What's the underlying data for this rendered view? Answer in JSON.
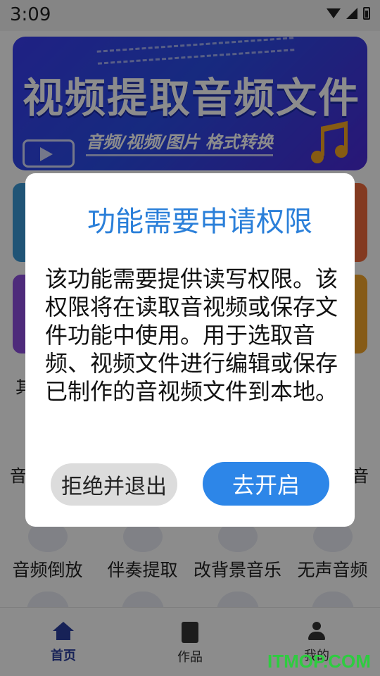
{
  "status_bar": {
    "time": "3:09"
  },
  "banner": {
    "title": "视频提取音频文件",
    "subtitle": "音频/视频/图片 格式转换"
  },
  "background_fragments": {
    "left_1": "其",
    "left_2": "音",
    "right_2": "音"
  },
  "functions": [
    {
      "label": "音频倒放"
    },
    {
      "label": "伴奏提取"
    },
    {
      "label": "改背景音乐"
    },
    {
      "label": "无声音频"
    }
  ],
  "bottom_nav": {
    "items": [
      {
        "label": "首页",
        "icon": "home-icon",
        "active": true
      },
      {
        "label": "作品",
        "icon": "document-icon",
        "active": false
      },
      {
        "label": "我的",
        "icon": "user-icon",
        "active": false
      }
    ]
  },
  "dialog": {
    "title": "功能需要申请权限",
    "body": "该功能需要提供读写权限。该权限将在读取音视频或保存文件功能中使用。用于选取音频、视频文件进行编辑或保存已制作的音视频文件到本地。",
    "refuse_button": "拒绝并退出",
    "confirm_button": "去开启"
  },
  "watermark": "ITMOP.COM",
  "colors": {
    "accent": "#2d86e8",
    "title_blue": "#2a7fd9",
    "nav_active": "#2a3f9e",
    "watermark": "#2ecc40"
  }
}
